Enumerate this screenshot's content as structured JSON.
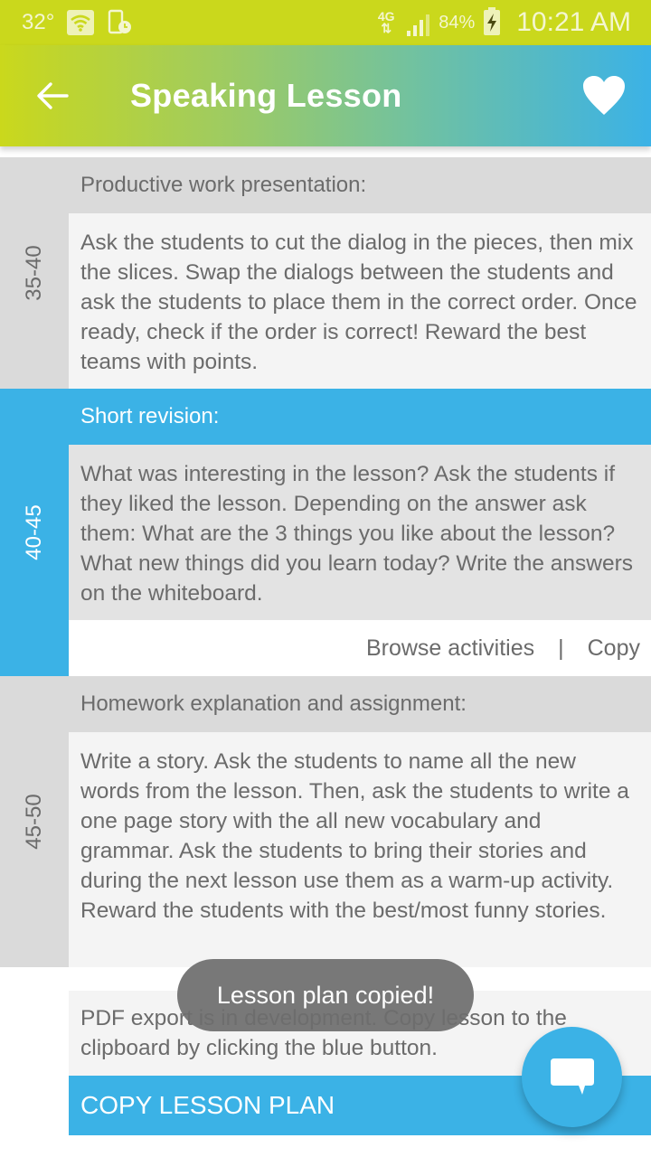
{
  "status_bar": {
    "temperature": "32°",
    "network_type": "4G",
    "battery_percent": "84%",
    "time": "10:21 AM",
    "icons": [
      "wifi-icon",
      "tablet-clock-icon",
      "network-4g-icon",
      "signal-icon",
      "battery-charging-icon"
    ]
  },
  "app_bar": {
    "title": "Speaking Lesson",
    "back_icon": "arrow-left-icon",
    "favorite_icon": "heart-icon"
  },
  "colors": {
    "status_bar": "#cad81c",
    "accent_blue": "#3bb2e6",
    "gradient_start": "#cad81c",
    "gradient_end": "#3bb2e6",
    "gray_block": "#dadada",
    "text_gray": "#6b6b6b"
  },
  "blocks": [
    {
      "time_range": "35-40",
      "title": "Productive work presentation:",
      "text": "Ask the students to cut the dialog in the pieces, then mix the slices. Swap the dialogs between the students and ask the students to place them in the correct order. Once ready, check if the order is correct! Reward the best teams with points.",
      "highlighted": false
    },
    {
      "time_range": "40-45",
      "title": "Short revision:",
      "text": "What was interesting in the lesson? Ask the students if they liked the lesson. Depending on the answer ask them: What are the 3 things you like about the lesson? What new things did you learn today? Write the answers on the whiteboard.",
      "highlighted": true,
      "actions": {
        "browse_label": "Browse activities",
        "separator": "|",
        "copy_label": "Copy"
      }
    },
    {
      "time_range": "45-50",
      "title": "Homework explanation and assignment:",
      "text": "Write a story. Ask the students to name all the new words from the lesson. Then, ask the students to write a one page story with the all new vocabulary and grammar. Ask the students to bring their stories and during the next lesson use them as a warm-up activity. Reward the students with the best/most funny stories.",
      "highlighted": false
    }
  ],
  "footer": {
    "note": "PDF export is in development. Copy lesson to the clipboard by clicking the blue button.",
    "copy_button_label": "COPY LESSON PLAN"
  },
  "toast": {
    "message": "Lesson plan copied!"
  },
  "fab": {
    "icon": "chat-bubble-icon"
  }
}
